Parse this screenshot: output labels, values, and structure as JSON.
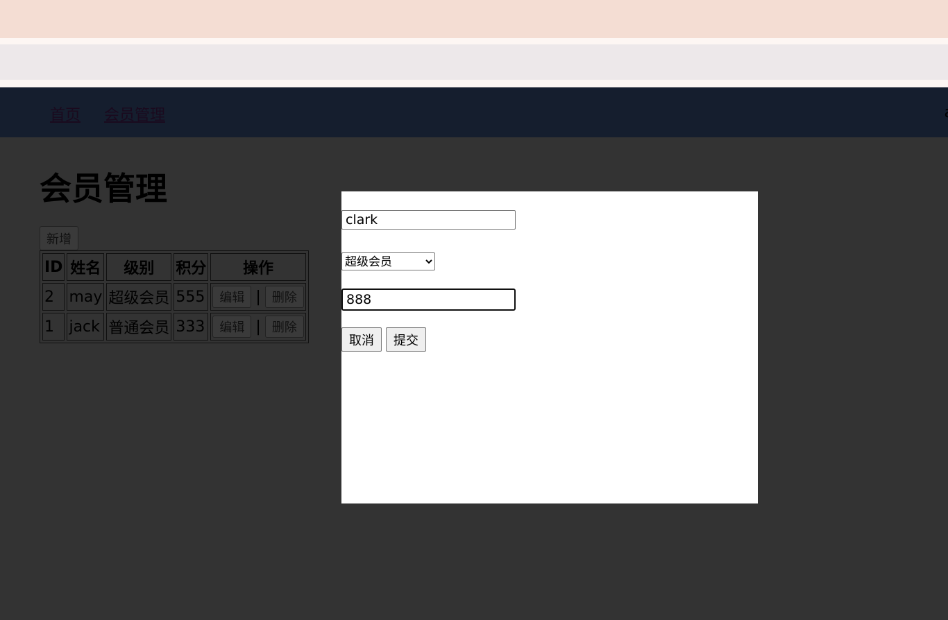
{
  "nav": {
    "links": [
      "首页",
      "会员管理"
    ],
    "user": "a"
  },
  "page": {
    "title": "会员管理",
    "add_label": "新增"
  },
  "table": {
    "headers": [
      "ID",
      "姓名",
      "级别",
      "积分",
      "操作"
    ],
    "rows": [
      {
        "id": "2",
        "name": "may",
        "level": "超级会员",
        "points": "555"
      },
      {
        "id": "1",
        "name": "jack",
        "level": "普通会员",
        "points": "333"
      }
    ],
    "edit_label": "编辑",
    "delete_label": "删除",
    "separator": "|"
  },
  "modal": {
    "name_value": "clark",
    "level_value": "超级会员",
    "level_options": [
      "超级会员"
    ],
    "points_value": "888",
    "cancel_label": "取消",
    "submit_label": "提交"
  }
}
